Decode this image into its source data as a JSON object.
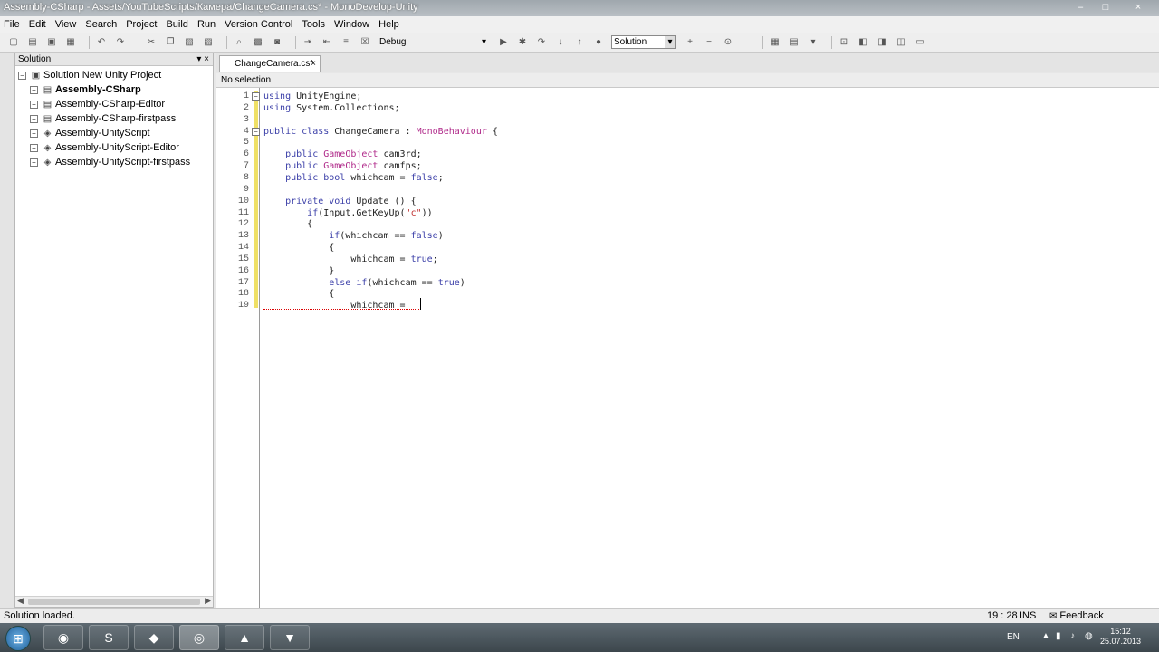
{
  "window": {
    "title": "Assembly-CSharp - Assets/YouTubeScripts/Камера/ChangeCamera.cs* - MonoDevelop-Unity",
    "controls": [
      "–",
      "□",
      "×"
    ]
  },
  "menu": [
    "File",
    "Edit",
    "View",
    "Search",
    "Project",
    "Build",
    "Run",
    "Version Control",
    "Tools",
    "Window",
    "Help"
  ],
  "toolbar": {
    "config": "Debug",
    "search_scope": "Solution"
  },
  "solution_pad": {
    "header": "Solution",
    "pin": "▾ ×",
    "items": [
      {
        "label": "Solution New Unity Project",
        "bold": false,
        "icon": "solution-icon"
      },
      {
        "label": "Assembly-CSharp",
        "bold": true,
        "icon": "csharp-project-icon"
      },
      {
        "label": "Assembly-CSharp-Editor",
        "bold": false,
        "icon": "csharp-project-icon"
      },
      {
        "label": "Assembly-CSharp-firstpass",
        "bold": false,
        "icon": "csharp-project-icon"
      },
      {
        "label": "Assembly-UnityScript",
        "bold": false,
        "icon": "unityscript-project-icon"
      },
      {
        "label": "Assembly-UnityScript-Editor",
        "bold": false,
        "icon": "unityscript-project-icon"
      },
      {
        "label": "Assembly-UnityScript-firstpass",
        "bold": false,
        "icon": "unityscript-project-icon"
      }
    ]
  },
  "editor": {
    "tab": "ChangeCamera.cs*",
    "tab_close": "×",
    "nav": "No selection",
    "lines": [
      {
        "n": "1",
        "text": "using UnityEngine;"
      },
      {
        "n": "2",
        "text": "using System.Collections;"
      },
      {
        "n": "3",
        "text": ""
      },
      {
        "n": "4",
        "text": "public class ChangeCamera : MonoBehaviour {"
      },
      {
        "n": "5",
        "text": ""
      },
      {
        "n": "6",
        "text": "    public GameObject cam3rd;"
      },
      {
        "n": "7",
        "text": "    public GameObject camfps;"
      },
      {
        "n": "8",
        "text": "    public bool whichcam = false;"
      },
      {
        "n": "9",
        "text": ""
      },
      {
        "n": "10",
        "text": "    private void Update () {"
      },
      {
        "n": "11",
        "text": "        if(Input.GetKeyUp(\"c\"))"
      },
      {
        "n": "12",
        "text": "        {"
      },
      {
        "n": "13",
        "text": "            if(whichcam == false)"
      },
      {
        "n": "14",
        "text": "            {"
      },
      {
        "n": "15",
        "text": "                whichcam = true;"
      },
      {
        "n": "16",
        "text": "            }"
      },
      {
        "n": "17",
        "text": "            else if(whichcam == true)"
      },
      {
        "n": "18",
        "text": "            {"
      },
      {
        "n": "19",
        "text": "                whichcam = "
      }
    ]
  },
  "status": {
    "message": "Solution loaded.",
    "position": "19 : 28",
    "mode": "INS",
    "feedback": "Feedback"
  },
  "taskbar": {
    "language": "EN",
    "time": "15:12",
    "date": "25.07.2013"
  }
}
